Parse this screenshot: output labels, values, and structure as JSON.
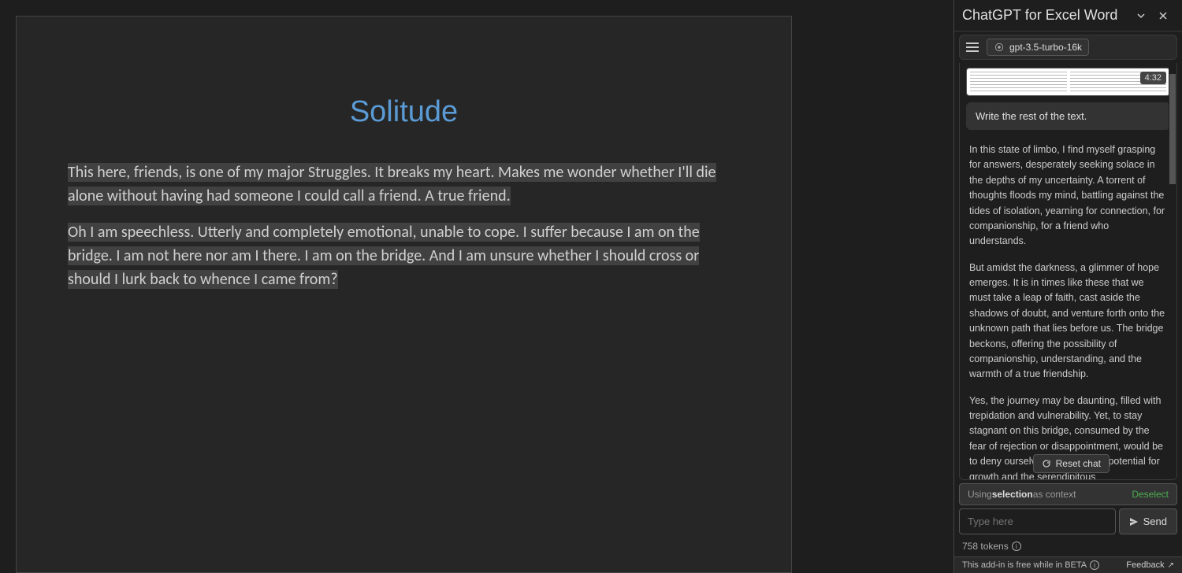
{
  "document": {
    "title": "Solitude",
    "paragraph1": "This here, friends, is one of my major Struggles. It breaks my heart. Makes me wonder whether I'll die alone without having had someone I could call a friend. A true friend.",
    "paragraph2": "Oh I am speechless. Utterly and completely emotional, unable to cope. I suffer because I am on the bridge. I am not here nor am I there. I am on the bridge. And I am unsure whether I should cross or should I lurk back to whence I came from?"
  },
  "panel": {
    "title": "ChatGPT for Excel Word",
    "model": "gpt-3.5-turbo-16k",
    "preview_time": "4:32",
    "user_message": "Write the rest of the text.",
    "assistant_p1": "In this state of limbo, I find myself grasping for answers, desperately seeking solace in the depths of my uncertainty. A torrent of thoughts floods my mind, battling against the tides of isolation, yearning for connection, for companionship, for a friend who understands.",
    "assistant_p2": "But amidst the darkness, a glimmer of hope emerges. It is in times like these that we must take a leap of faith, cast aside the shadows of doubt, and venture forth onto the unknown path that lies before us. The bridge beckons, offering the possibility of companionship, understanding, and the warmth of a true friendship.",
    "assistant_p3": "Yes, the journey may be daunting, filled with trepidation and vulnerability. Yet, to stay stagnant on this bridge, consumed by the fear of rejection or disappointment, would be to deny ourselves the immense potential for growth and the serendipitous",
    "reset_label": "Reset chat",
    "context_prefix": "Using ",
    "context_bold": "selection",
    "context_suffix": " as context",
    "deselect": "Deselect",
    "input_placeholder": "Type here",
    "send_label": "Send",
    "tokens": "758 tokens",
    "beta_text": "This add-in is free while in BETA",
    "feedback": "Feedback"
  }
}
